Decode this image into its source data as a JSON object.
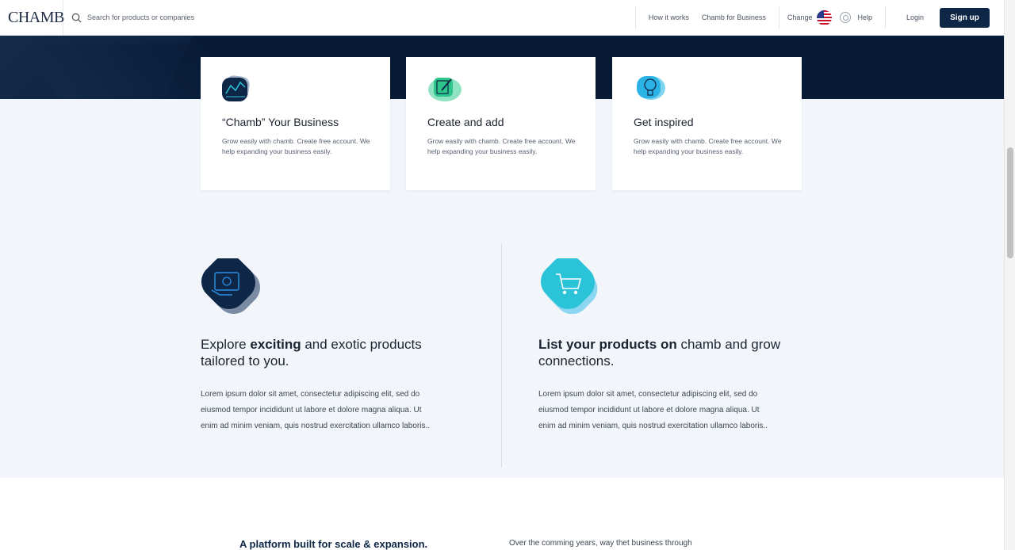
{
  "header": {
    "logo": "CHAMB",
    "search_placeholder": "Search for products or companies",
    "nav": {
      "how_it_works": "How it works",
      "chamb_for_business": "Chamb for Business",
      "change": "Change",
      "help": "Help",
      "login": "Login",
      "signup": "Sign up"
    }
  },
  "cards": [
    {
      "title": "“Chamb” Your Business",
      "text": "Grow easily with chamb. Create free account. We help expanding your business easily.",
      "icon": "chart-icon"
    },
    {
      "title": "Create and add",
      "text": "Grow easily with chamb. Create free account. We help expanding your business easily.",
      "icon": "pencil-edit-icon"
    },
    {
      "title": "Get inspired",
      "text": "Grow easily with chamb. Create free account. We help expanding your business easily.",
      "icon": "lightbulb-icon"
    }
  ],
  "features": [
    {
      "title_pre": "Explore ",
      "title_bold": "exciting",
      "title_post": " and exotic products tailored to you.",
      "text": "Lorem ipsum dolor sit amet, consectetur adipiscing elit, sed do eiusmod tempor incididunt ut labore et dolore magna aliqua. Ut enim ad minim veniam, quis nostrud exercitation ullamco laboris..",
      "icon": "money-hand-icon"
    },
    {
      "title_pre": "",
      "title_bold": "List your products on",
      "title_post": " chamb and grow connections.",
      "text": "Lorem ipsum dolor sit amet, consectetur adipiscing elit, sed do eiusmod tempor incididunt ut labore et dolore magna aliqua. Ut enim ad minim veniam, quis nostrud exercitation ullamco laboris..",
      "icon": "shopping-cart-icon"
    }
  ],
  "bottom": {
    "heading": "A platform built for scale & expansion.",
    "text": "Over the comming years, way thet business through"
  },
  "colors": {
    "brand": "#0f2747",
    "hero": "#071b36",
    "teal": "#2bc3d8",
    "green": "#2ec58a"
  }
}
